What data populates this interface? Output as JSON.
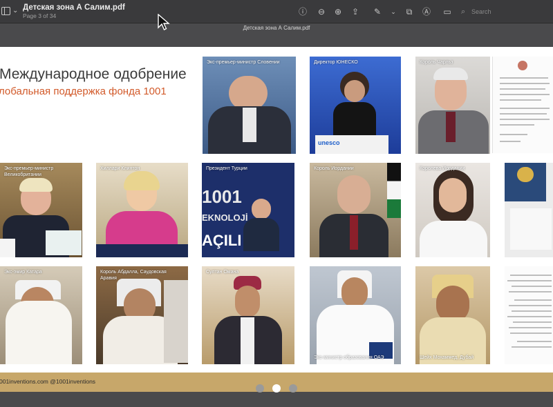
{
  "toolbar": {
    "doc_title": "Детская зона А Салим.pdf",
    "page_info": "Page 3 of 34",
    "search_placeholder": "Search",
    "icons": [
      "sidebar-icon",
      "info-icon",
      "zoom-out-icon",
      "zoom-in-icon",
      "share-icon",
      "markup-icon",
      "rotate-icon",
      "annotate-icon",
      "edit-icon",
      "search-icon"
    ]
  },
  "doc_strip_title": "Детская зона А Салим.pdf",
  "page": {
    "heading": "Международное одобрение",
    "subheading": "лобальная поддержка фонда 1001",
    "footer": "001inventions.com @1001inventions"
  },
  "photos": [
    {
      "caption": "Экс-премьер-министр Словении"
    },
    {
      "caption": "Директор ЮНЕСКО"
    },
    {
      "caption": "Король Чарльз"
    },
    {
      "caption": "Экс-премьер-министр Великобритании"
    },
    {
      "caption": "Хиллари Клинтон"
    },
    {
      "caption": "Президент Турции"
    },
    {
      "caption": "Король Иордании"
    },
    {
      "caption": "Королева Иордании"
    },
    {
      "caption": "Экс-эмир Катара"
    },
    {
      "caption": "Король Абдалла, Саудовская Аравия"
    },
    {
      "caption": "Султан Омана"
    },
    {
      "caption": "Экс-министр образования ОАЭ"
    },
    {
      "caption": "Шейх Мохаммед, Дубай"
    }
  ],
  "embedded_text": {
    "unesco_logo": "unesco",
    "banner_1001": "1001",
    "banner_line2": "EKNOLOJİ",
    "banner_line3": "AÇILI"
  },
  "colors": {
    "toolbar": "#3a3a3c",
    "subheading": "#d25a2a",
    "footer": "#c7a76a"
  },
  "pagination": {
    "total": 3,
    "active": 2
  }
}
